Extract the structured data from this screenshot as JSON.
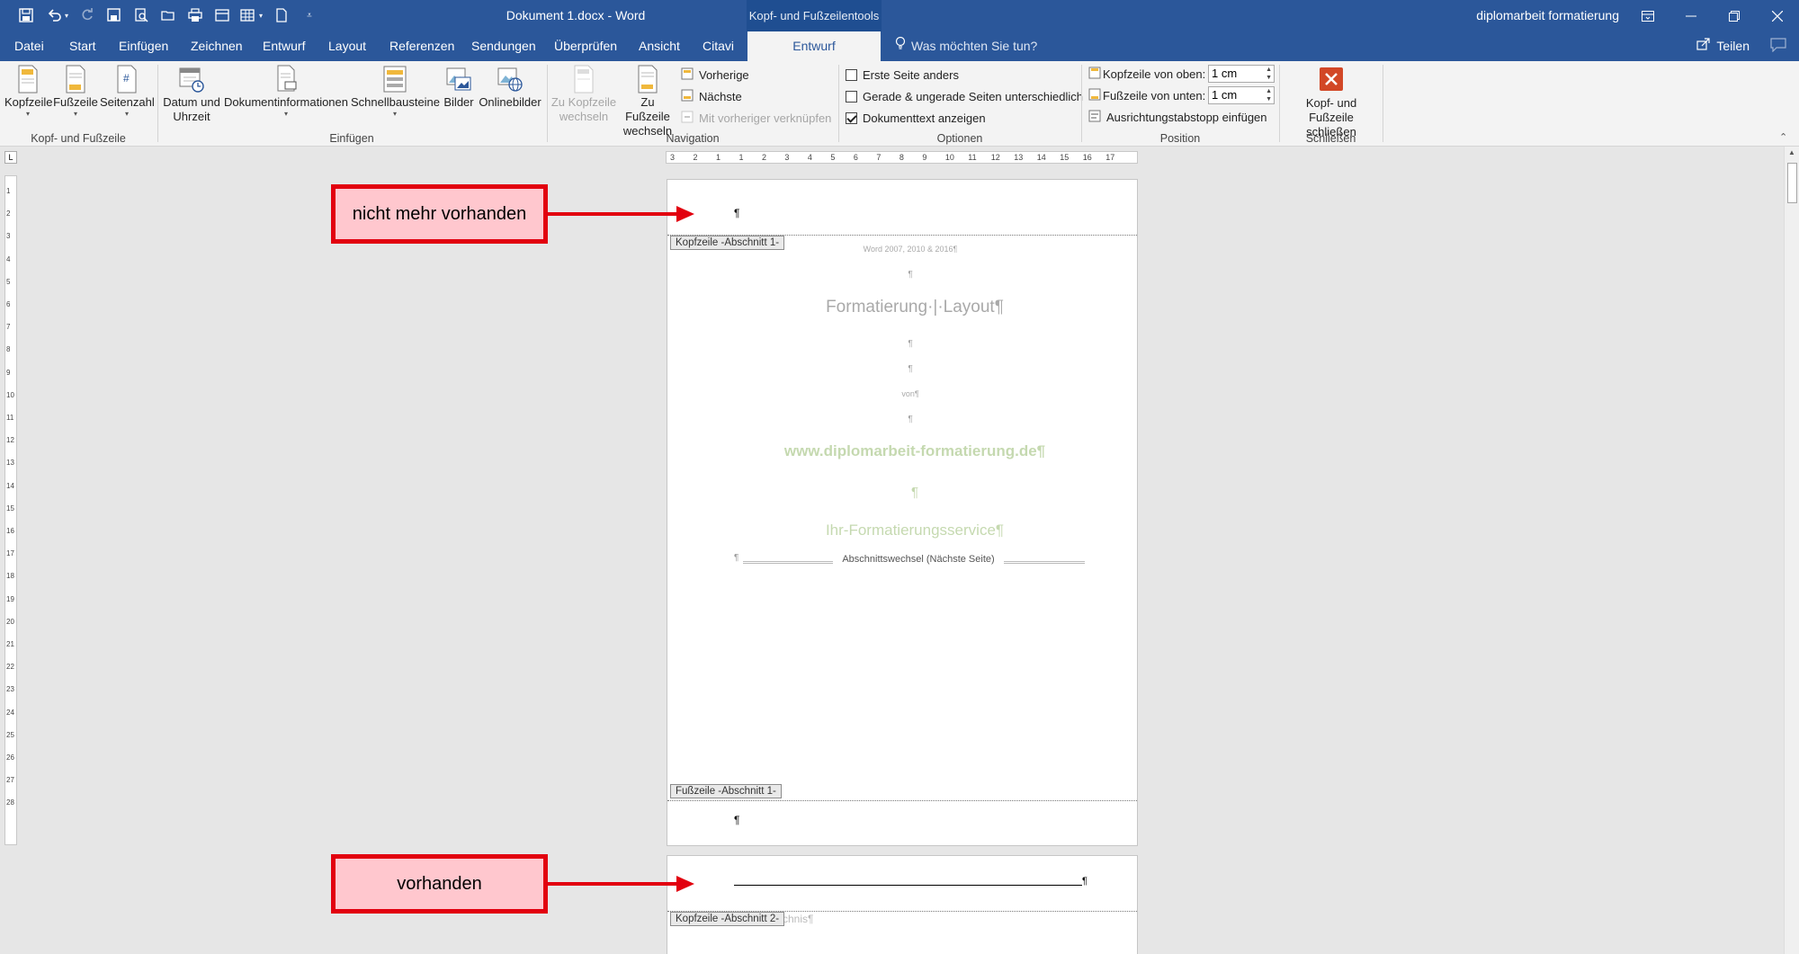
{
  "window": {
    "title": "Dokument 1.docx  -  Word",
    "context_tab_group": "Kopf- und Fußzeilentools",
    "user": "diplomarbeit formatierung",
    "share": "Teilen",
    "tell_me": "Was möchten Sie tun?"
  },
  "tabs": [
    "Datei",
    "Start",
    "Einfügen",
    "Zeichnen",
    "Entwurf",
    "Layout",
    "Referenzen",
    "Sendungen",
    "Überprüfen",
    "Ansicht",
    "Citavi",
    "Entwurf"
  ],
  "active_tab_index": 11,
  "ribbon": {
    "group_header_footer": {
      "label": "Kopf- und Fußzeile",
      "kopfzeile": "Kopfzeile",
      "fusszeile": "Fußzeile",
      "seitenzahl": "Seitenzahl"
    },
    "group_insert": {
      "label": "Einfügen",
      "datum_l1": "Datum und",
      "datum_l2": "Uhrzeit",
      "dokinfo": "Dokumentinformationen",
      "schnellbausteine": "Schnellbausteine",
      "bilder": "Bilder",
      "onlinebilder": "Onlinebilder"
    },
    "group_navigation": {
      "label": "Navigation",
      "zu_kopf_l1": "Zu Kopfzeile",
      "zu_kopf_l2": "wechseln",
      "zu_fuss_l1": "Zu Fußzeile",
      "zu_fuss_l2": "wechseln",
      "vorherige": "Vorherige",
      "naechste": "Nächste",
      "verknuepfen": "Mit vorheriger verknüpfen"
    },
    "group_options": {
      "label": "Optionen",
      "erste_seite": "Erste Seite anders",
      "gerade_ungerade": "Gerade & ungerade Seiten unterschiedlich",
      "dokumenttext": "Dokumenttext anzeigen",
      "erste_seite_checked": false,
      "gerade_ungerade_checked": false,
      "dokumenttext_checked": true
    },
    "group_position": {
      "label": "Position",
      "kopf_oben": "Kopfzeile von oben:",
      "kopf_oben_value": "1 cm",
      "fuss_unten": "Fußzeile von unten:",
      "fuss_unten_value": "1 cm",
      "tabstopp": "Ausrichtungstabstopp einfügen"
    },
    "group_close": {
      "label": "Schließen",
      "close_l1": "Kopf- und",
      "close_l2": "Fußzeile schließen"
    }
  },
  "page1": {
    "header_mark": "¶",
    "header_tag": "Kopfzeile -Abschnitt 1-",
    "line_small": "Word 2007, 2010 & 2016¶",
    "para": "¶",
    "title": "Formatierung·|·Layout¶",
    "von": "von¶",
    "url": "www.diplomarbeit-formatierung.de¶",
    "service": "Ihr-Formatierungsservice¶",
    "section_break": "Abschnittswechsel (Nächste Seite)",
    "footer_tag": "Fußzeile -Abschnitt 1-",
    "footer_mark": "¶"
  },
  "page2": {
    "header_tag": "Kopfzeile -Abschnitt 2-",
    "header_mark": "¶",
    "under_text": "...chnis¶"
  },
  "callouts": {
    "top": "nicht mehr vorhanden",
    "bottom": "vorhanden"
  },
  "ruler_numbers": [
    "3",
    "2",
    "1",
    "1",
    "2",
    "3",
    "4",
    "5",
    "6",
    "7",
    "8",
    "9",
    "10",
    "11",
    "12",
    "13",
    "14",
    "15",
    "16",
    "17"
  ],
  "colors": {
    "title_bar": "#2b579a",
    "callout_border": "#e2000f",
    "callout_fill": "#ffc7ce",
    "close_button": "#d24726",
    "url_color": "#c5d9b0"
  }
}
